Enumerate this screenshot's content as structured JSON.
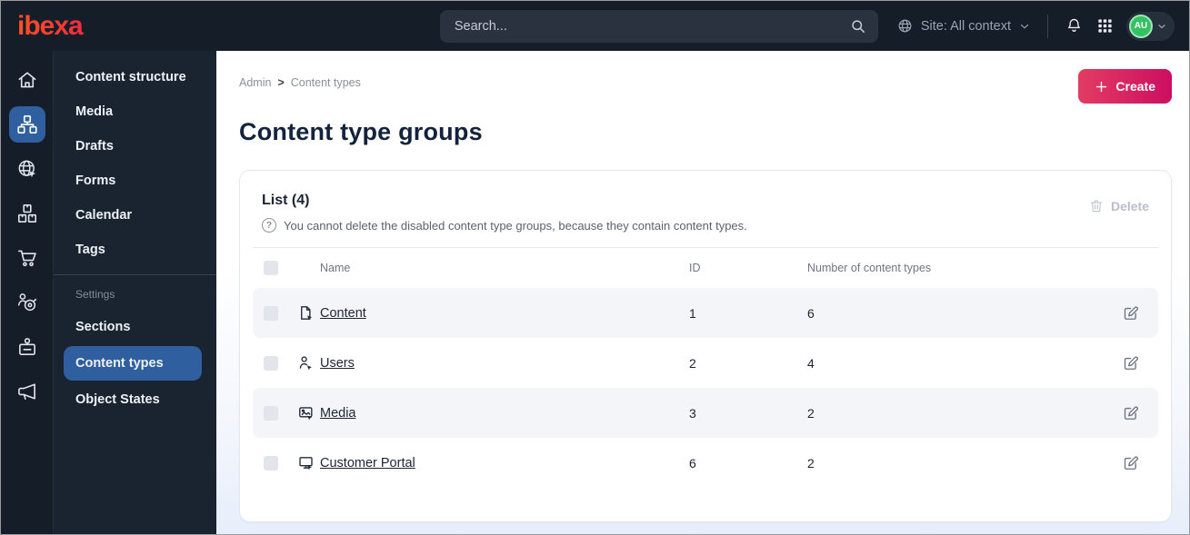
{
  "topbar": {
    "logo": "ibexa",
    "search_placeholder": "Search...",
    "site_context": "Site: All context",
    "avatar_initials": "AU"
  },
  "icon_rail": {
    "items": [
      "home",
      "content-structure",
      "site",
      "product-catalog",
      "cart",
      "segments",
      "badge",
      "megaphone"
    ],
    "active": "content-structure"
  },
  "sidebar": {
    "items": [
      "Content structure",
      "Media",
      "Drafts",
      "Forms",
      "Calendar",
      "Tags"
    ],
    "settings_label": "Settings",
    "settings_items": [
      "Sections",
      "Content types",
      "Object States"
    ],
    "active_item": "Content types"
  },
  "breadcrumb": {
    "items": [
      "Admin",
      "Content types"
    ],
    "separator": ">"
  },
  "page": {
    "title": "Content type groups",
    "create_label": "Create"
  },
  "list_card": {
    "title": "List (4)",
    "help_icon": "?",
    "help_text": "You cannot delete the disabled content type groups, because they contain content types.",
    "delete_label": "Delete",
    "columns": [
      "Name",
      "ID",
      "Number of content types"
    ],
    "rows": [
      {
        "icon": "file-icon",
        "name": "Content",
        "id": "1",
        "count": "6"
      },
      {
        "icon": "user-icon",
        "name": "Users",
        "id": "2",
        "count": "4"
      },
      {
        "icon": "image-icon",
        "name": "Media",
        "id": "3",
        "count": "2"
      },
      {
        "icon": "monitor-icon",
        "name": "Customer Portal",
        "id": "6",
        "count": "2"
      }
    ]
  },
  "colors": {
    "topbar_bg": "#151d28",
    "sidebar_bg": "#1a2431",
    "active_blue": "#2f5f9f",
    "create_gradient_start": "#e23c62",
    "create_gradient_end": "#cc0f61",
    "avatar_green": "#35c162",
    "row_stripe": "#f4f5f8",
    "page_gradient_bottom": "#e7eefb"
  }
}
